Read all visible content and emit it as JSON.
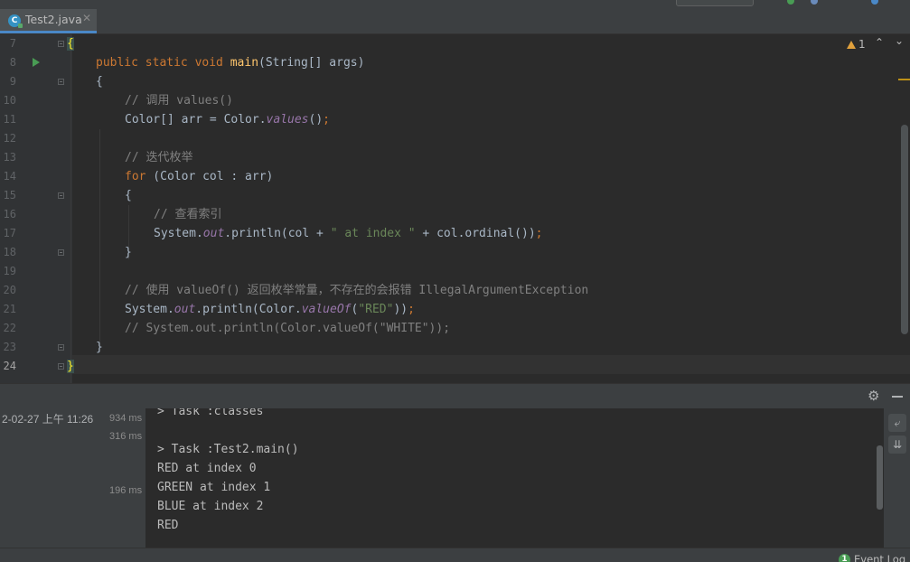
{
  "tab": {
    "filename": "Test2.java",
    "icon": "java-class-icon",
    "close": "✕"
  },
  "editor": {
    "inspection": {
      "count": "1",
      "icon": "warning-icon"
    },
    "nav_up": "⌃",
    "nav_down": "⌄",
    "line_numbers": [
      "7",
      "8",
      "9",
      "10",
      "11",
      "12",
      "13",
      "14",
      "15",
      "16",
      "17",
      "18",
      "19",
      "20",
      "21",
      "22",
      "23",
      "24"
    ],
    "current_line": "24",
    "tokens": {
      "l1_brace": "{",
      "l2_mod": "public static void ",
      "l2_name": "main",
      "l2_rest": "(String[] args)",
      "l3": "{",
      "l4": "// 调用 values()",
      "l5_a": "Color[] arr = Color.",
      "l5_b": "values",
      "l5_c": "()",
      "l5_d": ";",
      "l7": "// 迭代枚举",
      "l8_kw": "for",
      "l8_rest": " (Color col : arr)",
      "l9": "{",
      "l10": "// 查看索引",
      "l11_a": "System.",
      "l11_b": "out",
      "l11_c": ".println(col + ",
      "l11_d": "\" at index \"",
      "l11_e": " + col.ordinal())",
      "l11_f": ";",
      "l12": "}",
      "l14": "// 使用 valueOf() 返回枚举常量，不存在的会报错 IllegalArgumentException",
      "l15_a": "System.",
      "l15_b": "out",
      "l15_c": ".println(Color.",
      "l15_d": "valueOf",
      "l15_e": "(",
      "l15_f": "\"RED\"",
      "l15_g": "))",
      "l15_h": ";",
      "l16": "// System.out.println(Color.valueOf(\"WHITE\"));",
      "l17": "}",
      "l18": "}"
    }
  },
  "run": {
    "header_icons": [
      "gear-icon",
      "hide-icon"
    ],
    "tree": {
      "timestamp": "2-02-27 上午 11:26",
      "d1": "934 ms",
      "d2": "316 ms",
      "d3": "196 ms"
    },
    "console_lines": [
      "> Task :classes",
      "",
      "> Task :Test2.main()",
      "RED at index 0",
      "GREEN at index 1",
      "BLUE at index 2",
      "RED"
    ],
    "side_buttons": [
      "soft-wrap-icon",
      "scroll-to-end-icon"
    ]
  },
  "status": {
    "event_count": "1",
    "event_log": "Event Log"
  },
  "colors": {
    "keyword": "#cc7832",
    "method": "#ffc66d",
    "string": "#6a8759",
    "comment": "#808080",
    "field": "#9876aa",
    "text": "#a9b7c6"
  }
}
